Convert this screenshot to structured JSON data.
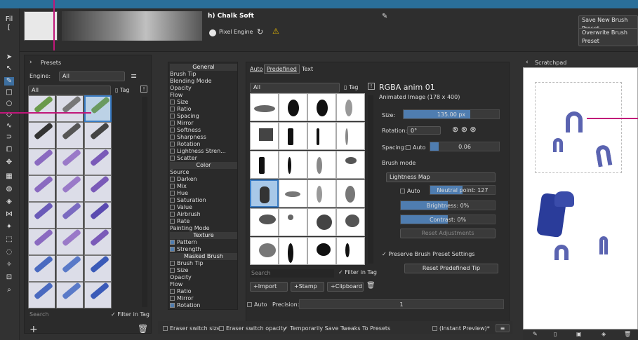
{
  "app": {
    "left_labels": [
      "Fil",
      "["
    ]
  },
  "header": {
    "preset_name": "h) Chalk Soft",
    "pixel_engine_label": "Pixel Engine",
    "save_new_label": "Save New Brush Preset",
    "overwrite_label": "Overwrite Brush Preset"
  },
  "presets": {
    "title": "Presets",
    "engine_label": "Engine:",
    "engine_value": "All",
    "filter_all": "All",
    "tag_label": "Tag",
    "search_placeholder": "Search",
    "filter_in_tag": "Filter in Tag"
  },
  "options": {
    "items": [
      "General",
      "Brush Tip",
      "Blending Mode",
      "Opacity",
      "Flow",
      "Size",
      "Ratio",
      "Spacing",
      "Mirror",
      "Softness",
      "Sharpness",
      "Rotation",
      "Lightness Stren...",
      "Scatter",
      "Color",
      "Source",
      "Darken",
      "Mix",
      "Hue",
      "Saturation",
      "Value",
      "Airbrush",
      "Rate",
      "Painting Mode",
      "Texture",
      "Pattern",
      "Strength",
      "Masked Brush",
      "Brush Tip",
      "Size",
      "Opacity",
      "Flow",
      "Ratio",
      "Mirror",
      "Rotation"
    ]
  },
  "tabs": {
    "auto": "Auto",
    "predefined": "Predefined",
    "text": "Text"
  },
  "tip": {
    "filter_all": "All",
    "tag_label": "Tag",
    "name": "RGBA anim 01",
    "type": "Animated Image (178 x 400)",
    "search_placeholder": "Search",
    "filter_in_tag": "Filter in Tag",
    "import_label": "Import",
    "stamp_label": "Stamp",
    "clipboard_label": "Clipboard",
    "size_label": "Size:",
    "size_value": "135.00 px",
    "rotation_label": "Rotation:",
    "rotation_value": "0°",
    "spacing_label": "Spacing:",
    "auto_label": "Auto",
    "spacing_value": "0.06",
    "brush_mode_label": "Brush mode",
    "brush_mode_value": "Lightness Map",
    "neutral_label": "Neutral point: 127",
    "brightness_label": "Brightness: 0%",
    "contrast_label": "Contrast: 0%",
    "reset_adjustments": "Reset Adjustments",
    "preserve_label": "Preserve Brush Preset Settings",
    "reset_tip": "Reset Predefined Tip",
    "precision_label": "Precision:",
    "precision_value": "1"
  },
  "scratchpad": {
    "title": "Scratchpad"
  },
  "footer": {
    "eraser_size": "Eraser switch size",
    "eraser_opacity": "Eraser switch opacity",
    "temp_save": "Temporarily Save Tweaks To Presets",
    "instant_preview": "(Instant Preview)*"
  }
}
